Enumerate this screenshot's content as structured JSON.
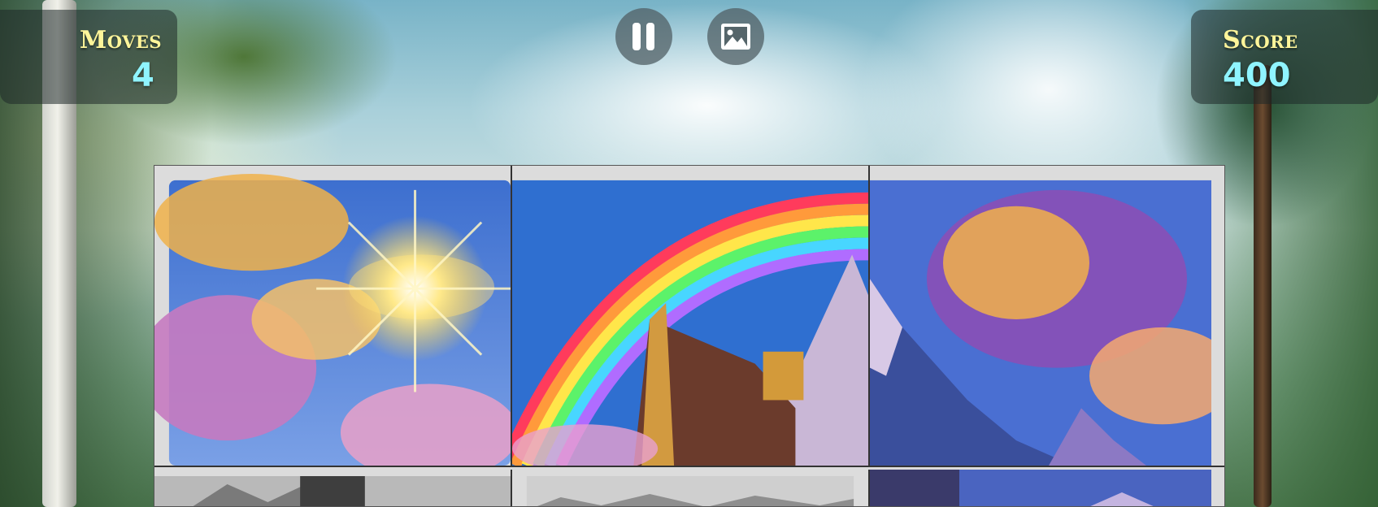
{
  "hud": {
    "moves": {
      "label": "Moves",
      "value": "4"
    },
    "score": {
      "label": "Score",
      "value": "400"
    }
  },
  "controls": {
    "pause": {
      "icon": "pause-icon"
    },
    "preview": {
      "icon": "image-icon"
    }
  },
  "puzzle": {
    "grid": {
      "columns": 3,
      "rows_visible": 2
    },
    "placed_tiles": [
      "sun-and-clouds",
      "rainbow-and-ark",
      "mountain-and-clouds"
    ],
    "unplaced_tiles_grayscale": true
  },
  "colors": {
    "label": "#fff59a",
    "value": "#8ff4ff"
  }
}
